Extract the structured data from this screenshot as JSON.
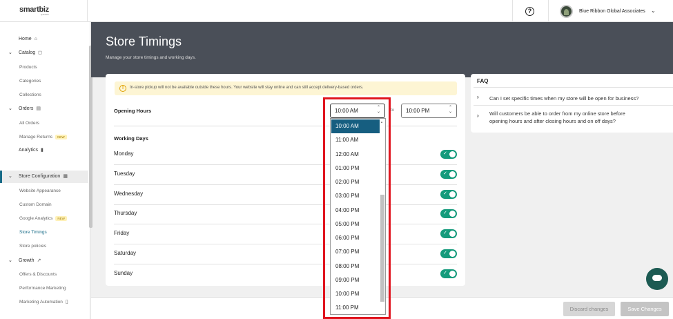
{
  "header": {
    "logo": "smartbiz",
    "logo_sub": "by amazon",
    "help_icon": "question-circle-icon",
    "account_name": "Blue Ribbon Global Associates"
  },
  "sidebar": {
    "home": "Home",
    "catalog": "Catalog",
    "products": "Products",
    "categories": "Categories",
    "collections": "Collections",
    "orders": "Orders",
    "all_orders": "All Orders",
    "manage_returns": "Manage Returns",
    "new_badge": "NEW",
    "analytics": "Analytics",
    "store_configuration": "Store Configuration",
    "website_appearance": "Website Appearance",
    "custom_domain": "Custom Domain",
    "google_analytics": "Google Analytics",
    "store_timings": "Store Timings",
    "store_policies": "Store policies",
    "growth": "Growth",
    "offers_discounts": "Offers & Discounts",
    "performance_marketing": "Performance Marketing",
    "marketing_automation": "Marketing Automation"
  },
  "page": {
    "title": "Store Timings",
    "subtitle": "Manage your store timings and working days."
  },
  "warning": "In-store pickup will not be available outside these hours. Your website will stay online and can still accept delivery-based orders.",
  "opening_hours": {
    "label": "Opening Hours",
    "from": "10:00 AM",
    "to_label": "to",
    "to": "10:00 PM"
  },
  "working_days": {
    "label": "Working Days",
    "days": [
      "Monday",
      "Tuesday",
      "Wednesday",
      "Thursday",
      "Friday",
      "Saturday",
      "Sunday"
    ],
    "enabled": [
      true,
      true,
      true,
      true,
      true,
      true,
      true
    ]
  },
  "dropdown_options": [
    "10:00 AM",
    "11:00 AM",
    "12:00 AM",
    "01:00 PM",
    "02:00 PM",
    "03:00 PM",
    "04:00 PM",
    "05:00 PM",
    "06:00 PM",
    "07:00 PM",
    "08:00 PM",
    "09:00 PM",
    "10:00 PM",
    "11:00 PM"
  ],
  "faq": {
    "title": "FAQ",
    "q1": "Can I set specific times when my store will be open for business?",
    "q2a": "Will customers be able to order from my online store before",
    "q2b": "opening hours and after closing hours and on off days?"
  },
  "footer": {
    "discard": "Discard changes",
    "save": "Save Changes"
  },
  "colors": {
    "accent": "#176b87",
    "toggle_on": "#159b7c",
    "highlight_box": "#e0141e"
  }
}
